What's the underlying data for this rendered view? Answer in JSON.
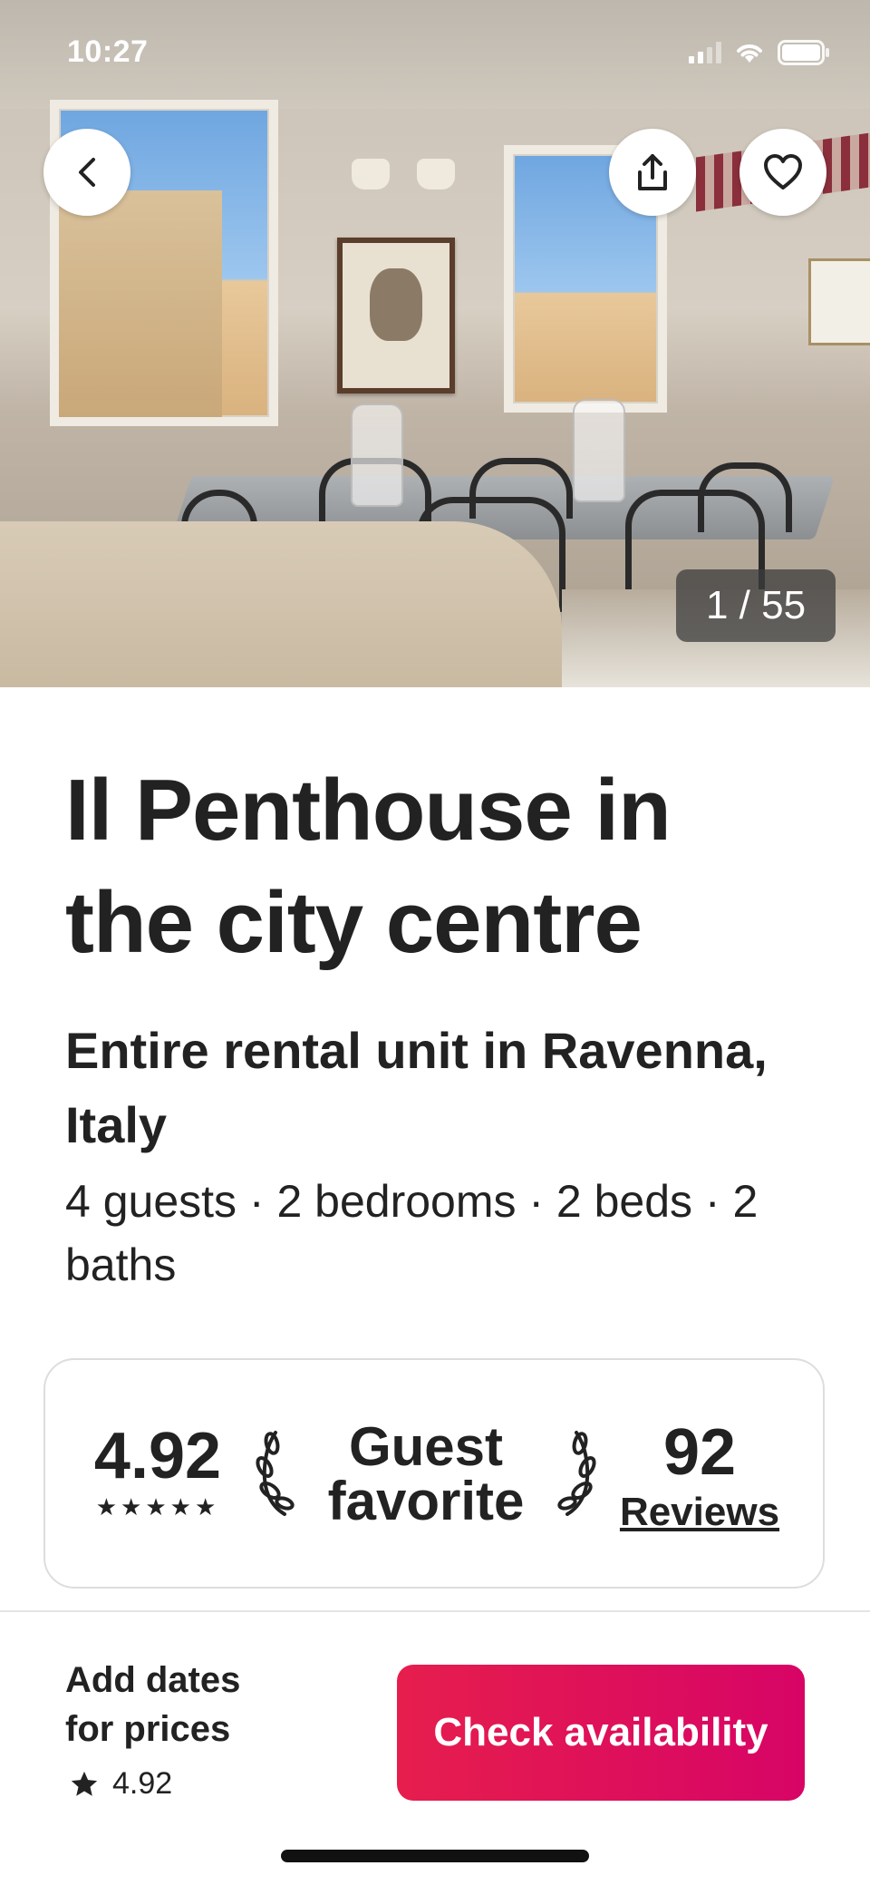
{
  "status_bar": {
    "time": "10:27"
  },
  "hero": {
    "photo_counter": "1 / 55"
  },
  "listing": {
    "title": "Il Penthouse in the city centre",
    "subtitle": "Entire rental unit in Ravenna, Italy",
    "details": "4 guests · 2 bedrooms · 2 beds · 2 baths"
  },
  "rating_card": {
    "rating": "4.92",
    "stars": "★★★★★",
    "badge_line1": "Guest",
    "badge_line2": "favorite",
    "review_count": "92",
    "reviews_label": "Reviews"
  },
  "bottom_bar": {
    "price_line1": "Add dates",
    "price_line2": "for prices",
    "rating": "4.92",
    "cta_label": "Check availability"
  },
  "colors": {
    "cta": "#e61e4d",
    "text": "#222222"
  }
}
